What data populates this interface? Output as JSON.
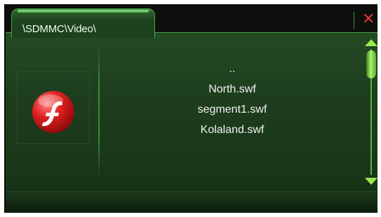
{
  "header": {
    "path": "\\SDMMC\\Video\\",
    "close_glyph": "✕"
  },
  "preview": {
    "icon": "flash-icon"
  },
  "files": [
    {
      "name": ".."
    },
    {
      "name": "North.swf"
    },
    {
      "name": "segment1.swf"
    },
    {
      "name": "Kolaland.swf"
    }
  ],
  "colors": {
    "panel_green": "#1f411f",
    "accent_green": "#9ae94e",
    "close_red": "#e03838",
    "flash_red": "#d81818"
  }
}
